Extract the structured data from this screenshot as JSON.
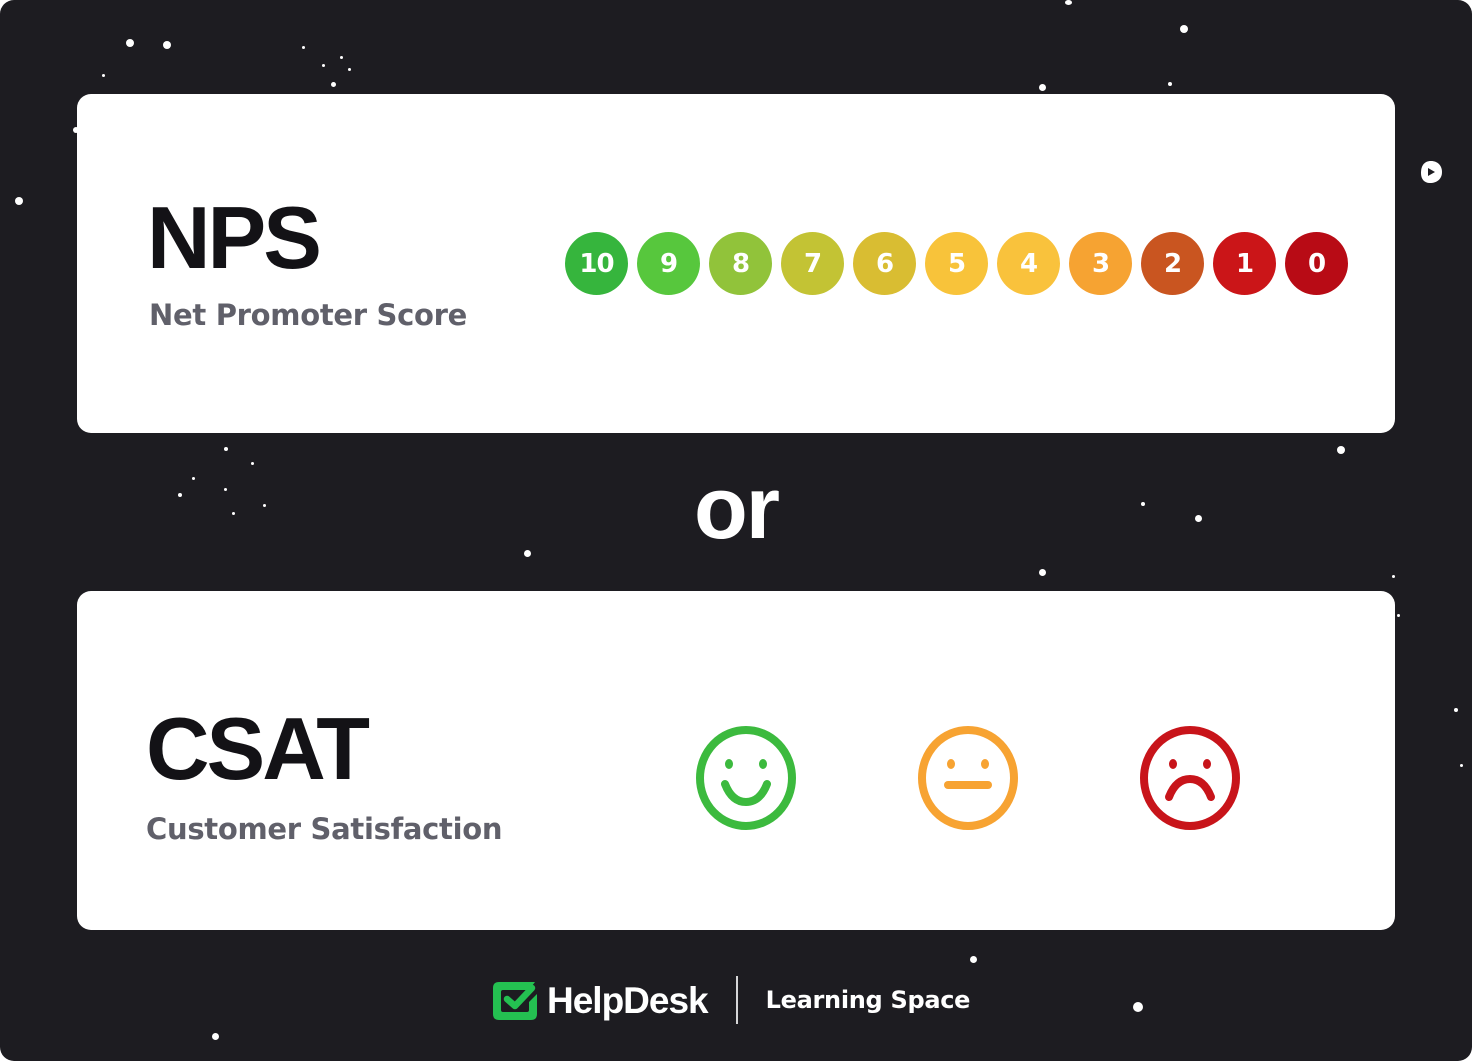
{
  "nps": {
    "title": "NPS",
    "subtitle": "Net Promoter Score",
    "scale": [
      {
        "label": "10",
        "color": "#36b53d"
      },
      {
        "label": "9",
        "color": "#57c73d"
      },
      {
        "label": "8",
        "color": "#91c33a"
      },
      {
        "label": "7",
        "color": "#c3c334"
      },
      {
        "label": "6",
        "color": "#d9bd32"
      },
      {
        "label": "5",
        "color": "#f8c33a"
      },
      {
        "label": "4",
        "color": "#f9c23c"
      },
      {
        "label": "3",
        "color": "#f6a332"
      },
      {
        "label": "2",
        "color": "#c95520"
      },
      {
        "label": "1",
        "color": "#cb1518"
      },
      {
        "label": "0",
        "color": "#b80b15"
      }
    ]
  },
  "separator": "or",
  "csat": {
    "title": "CSAT",
    "subtitle": "Customer Satisfaction",
    "faces": [
      {
        "icon": "happy-face-icon",
        "mood": "satisfied",
        "color": "#3cba3e"
      },
      {
        "icon": "neutral-face-icon",
        "mood": "neutral",
        "color": "#f7a332"
      },
      {
        "icon": "sad-face-icon",
        "mood": "dissatisfied",
        "color": "#c8141a"
      }
    ]
  },
  "footer": {
    "logo_icon": "checkbox-check-icon",
    "brand": "HelpDesk",
    "tagline": "Learning Space",
    "brand_color": "#24c051"
  }
}
